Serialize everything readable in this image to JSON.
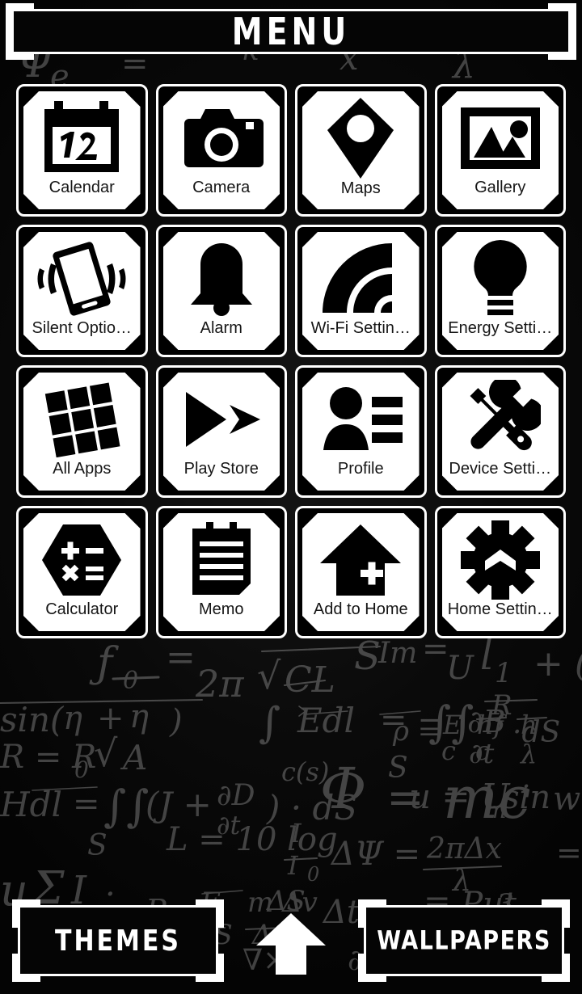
{
  "header": {
    "title": "MENU"
  },
  "theme": {
    "background_color": "#070707",
    "tile_face_color": "#ffffff",
    "tile_border_color": "#ffffff",
    "icon_color": "#000000",
    "label_color": "#161616",
    "accent_text_color": "#ffffff"
  },
  "app_grid": {
    "columns": 4,
    "rows": 4,
    "items": [
      {
        "label": "Calendar",
        "icon": "calendar-icon"
      },
      {
        "label": "Camera",
        "icon": "camera-icon"
      },
      {
        "label": "Maps",
        "icon": "map-pin-icon"
      },
      {
        "label": "Gallery",
        "icon": "gallery-icon"
      },
      {
        "label": "Silent Optio…",
        "icon": "vibrate-phone-icon"
      },
      {
        "label": "Alarm",
        "icon": "bell-icon"
      },
      {
        "label": "Wi-Fi Settin…",
        "icon": "wifi-icon"
      },
      {
        "label": "Energy Setti…",
        "icon": "lightbulb-icon"
      },
      {
        "label": "All Apps",
        "icon": "app-grid-icon"
      },
      {
        "label": "Play Store",
        "icon": "play-store-icon"
      },
      {
        "label": "Profile",
        "icon": "person-list-icon"
      },
      {
        "label": "Device Setti…",
        "icon": "wrench-screwdriver-icon"
      },
      {
        "label": "Calculator",
        "icon": "calculator-hexagon-icon"
      },
      {
        "label": "Memo",
        "icon": "notepad-icon"
      },
      {
        "label": "Add to Home",
        "icon": "house-plus-icon"
      },
      {
        "label": "Home Settin…",
        "icon": "gear-house-icon"
      }
    ]
  },
  "bottom_bar": {
    "themes_label": "THEMES",
    "wallpapers_label": "WALLPAPERS",
    "home_arrow_icon": "arrow-up-icon"
  },
  "calendar_icon": {
    "day_number": "12"
  }
}
